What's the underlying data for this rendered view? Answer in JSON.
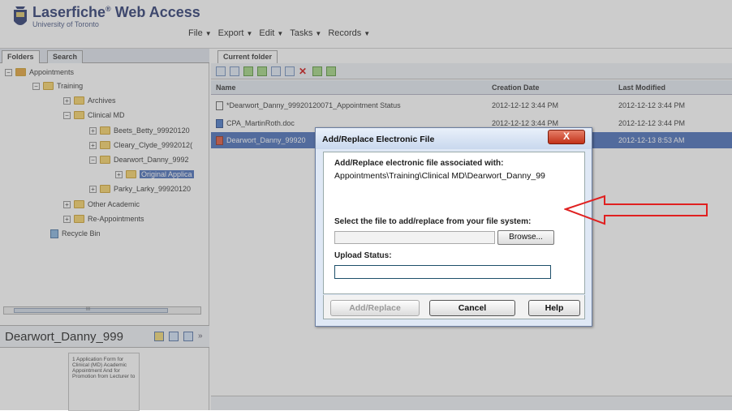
{
  "app": {
    "brand": "Laserfiche",
    "brand_mark": "®",
    "product": "Web Access",
    "university": "University of Toronto"
  },
  "menu": [
    {
      "label": "File"
    },
    {
      "label": "Export"
    },
    {
      "label": "Edit"
    },
    {
      "label": "Tasks"
    },
    {
      "label": "Records"
    }
  ],
  "left_tabs": {
    "folders": "Folders",
    "search": "Search"
  },
  "tree": {
    "appointments": "Appointments",
    "training": "Training",
    "archives": "Archives",
    "clinical_md": "Clinical MD",
    "beets": "Beets_Betty_99920120",
    "cleary": "Cleary_Clyde_9992012(",
    "dearwort": "Dearwort_Danny_9992",
    "original": "Original Applica",
    "parky": "Parky_Larky_99920120",
    "other_academic": "Other Academic",
    "reappointments": "Re-Appointments",
    "recycle_bin": "Recycle Bin",
    "scroll_mark": "III"
  },
  "metadata": {
    "title": "Dearwort_Danny_999",
    "thumbnail_text": "1 Application Form for Clinical (MD) Academic Appointment And for Promotion from Lecturer to"
  },
  "right_tab": "Current folder",
  "columns": {
    "name": "Name",
    "created": "Creation Date",
    "modified": "Last Modified"
  },
  "rows": [
    {
      "name": "*Dearwort_Danny_99920120071_Appointment Status",
      "created": "2012-12-12 3:44 PM",
      "modified": "2012-12-12 3:44 PM"
    },
    {
      "name": "CPA_MartinRoth.doc",
      "created": "2012-12-12 3:44 PM",
      "modified": "2012-12-12 3:44 PM"
    },
    {
      "name": "Dearwort_Danny_99920",
      "created": "",
      "modified": "2012-12-13 8:53 AM"
    }
  ],
  "dialog": {
    "title": "Add/Replace Electronic File",
    "close": "X",
    "assoc_label": "Add/Replace electronic file associated with:",
    "path": "Appointments\\Training\\Clinical MD\\Dearwort_Danny_99",
    "select_label": "Select the file to add/replace from your file system:",
    "browse": "Browse...",
    "upload_label": "Upload Status:",
    "btn_add": "Add/Replace",
    "btn_cancel": "Cancel",
    "btn_help": "Help"
  },
  "colors": {
    "accent": "#3b63b4",
    "annotation_arrow": "#e02020",
    "close_button": "#c2321a"
  }
}
